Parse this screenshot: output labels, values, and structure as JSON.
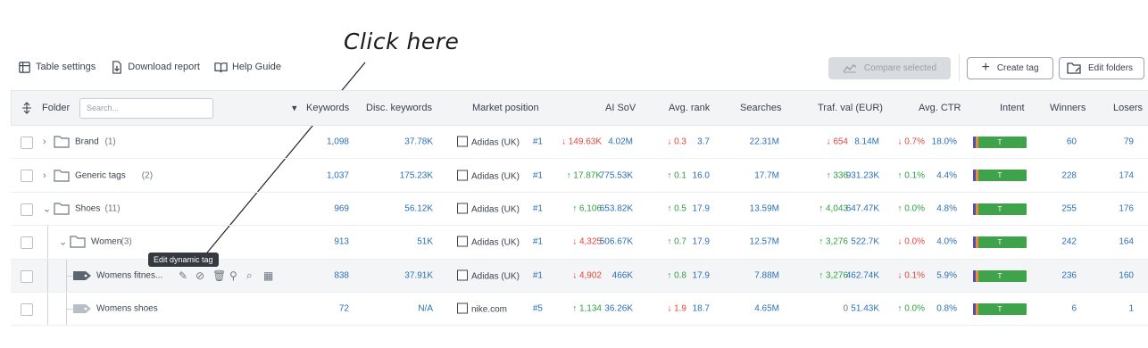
{
  "annotation": {
    "text": "Click here"
  },
  "toolbar": {
    "table_settings": "Table settings",
    "download_report": "Download report",
    "help_guide": "Help Guide"
  },
  "actions": {
    "compare_selected": "Compare selected",
    "create_tag": "Create tag",
    "edit_folders": "Edit folders"
  },
  "header": {
    "folder": "Folder",
    "search_placeholder": "Search...",
    "keywords": "Keywords",
    "disc_keywords": "Disc. keywords",
    "market_position": "Market position",
    "ai_sov": "AI SoV",
    "avg_rank": "Avg. rank",
    "searches": "Searches",
    "traf_val": "Traf. val (EUR)",
    "avg_ctr": "Avg. CTR",
    "intent": "Intent",
    "winners": "Winners",
    "losers": "Losers"
  },
  "tooltip": "Edit dynamic tag",
  "intent_colors": {
    "navigational": "#4a4fc4",
    "informational": "#f08c2e",
    "transactional": "#3ea34a",
    "commercial": "#e6c229"
  },
  "rows": [
    {
      "name": "Brand",
      "count": "(1)",
      "keywords": "1,098",
      "disc": "37.78K",
      "brand": "Adidas (UK)",
      "pos": "#1",
      "sov_delta": "149.63K",
      "sov_dir": "down",
      "sov": "4.02M",
      "rank_delta": "0.3",
      "rank_dir": "down",
      "rank": "3.7",
      "searches": "22.31M",
      "traf_delta": "654",
      "traf_dir": "down",
      "traf": "8.14M",
      "ctr_delta": "0.7%",
      "ctr_dir": "down",
      "ctr": "18.0%",
      "intent": "T",
      "winners": "60",
      "losers": "79"
    },
    {
      "name": "Generic tags",
      "count": "(2)",
      "keywords": "1,037",
      "disc": "175.23K",
      "brand": "Adidas (UK)",
      "pos": "#1",
      "sov_delta": "17.87K",
      "sov_dir": "up",
      "sov": "775.53K",
      "rank_delta": "0.1",
      "rank_dir": "up",
      "rank": "16.0",
      "searches": "17.7M",
      "traf_delta": "336",
      "traf_dir": "up",
      "traf": "931.23K",
      "ctr_delta": "0.1%",
      "ctr_dir": "up",
      "ctr": "4.4%",
      "intent": "T",
      "winners": "228",
      "losers": "174"
    },
    {
      "name": "Shoes",
      "count": "(11)",
      "keywords": "969",
      "disc": "56.12K",
      "brand": "Adidas (UK)",
      "pos": "#1",
      "sov_delta": "6,106",
      "sov_dir": "up",
      "sov": "653.82K",
      "rank_delta": "0.5",
      "rank_dir": "up",
      "rank": "17.9",
      "searches": "13.59M",
      "traf_delta": "4,043",
      "traf_dir": "up",
      "traf": "647.47K",
      "ctr_delta": "0.0%",
      "ctr_dir": "up",
      "ctr": "4.8%",
      "intent": "T",
      "winners": "255",
      "losers": "176"
    },
    {
      "name": "Women",
      "count": "(3)",
      "keywords": "913",
      "disc": "51K",
      "brand": "Adidas (UK)",
      "pos": "#1",
      "sov_delta": "4,325",
      "sov_dir": "down",
      "sov": "506.67K",
      "rank_delta": "0.7",
      "rank_dir": "up",
      "rank": "17.9",
      "searches": "12.57M",
      "traf_delta": "3,276",
      "traf_dir": "up",
      "traf": "522.7K",
      "ctr_delta": "0.0%",
      "ctr_dir": "down",
      "ctr": "4.0%",
      "intent": "T",
      "winners": "242",
      "losers": "164"
    },
    {
      "name": "Womens fitnes...",
      "count": "",
      "keywords": "838",
      "disc": "37.91K",
      "brand": "Adidas (UK)",
      "pos": "#1",
      "sov_delta": "4,902",
      "sov_dir": "down",
      "sov": "466K",
      "rank_delta": "0.8",
      "rank_dir": "up",
      "rank": "17.9",
      "searches": "7.88M",
      "traf_delta": "3,276",
      "traf_dir": "up",
      "traf": "462.74K",
      "ctr_delta": "0.1%",
      "ctr_dir": "down",
      "ctr": "5.9%",
      "intent": "T",
      "winners": "236",
      "losers": "160"
    },
    {
      "name": "Womens shoes",
      "count": "",
      "keywords": "72",
      "disc": "N/A",
      "brand": "nike.com",
      "pos": "#5",
      "sov_delta": "1,134",
      "sov_dir": "up",
      "sov": "36.26K",
      "rank_delta": "1.9",
      "rank_dir": "down",
      "rank": "18.7",
      "searches": "4.65M",
      "traf_delta": "0",
      "traf_dir": "none",
      "traf": "51.43K",
      "ctr_delta": "0.0%",
      "ctr_dir": "up",
      "ctr": "0.8%",
      "intent": "T",
      "winners": "6",
      "losers": "1"
    }
  ]
}
